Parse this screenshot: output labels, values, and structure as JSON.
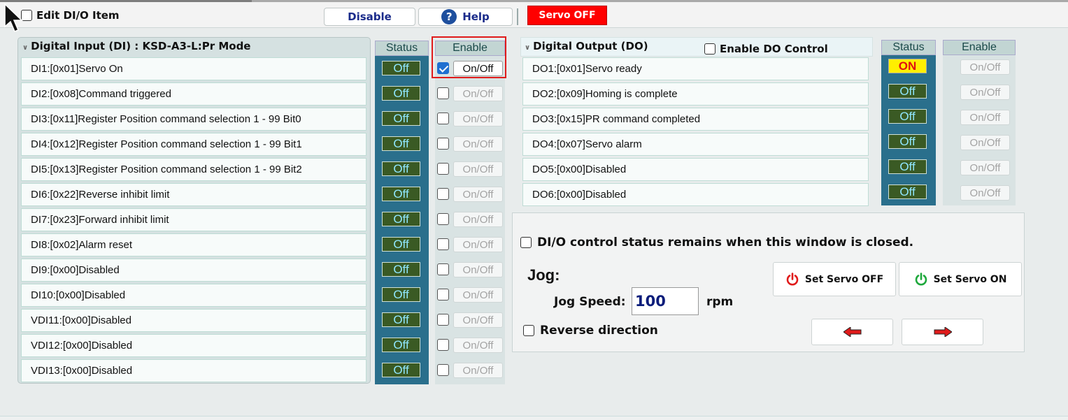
{
  "toolbar": {
    "edit_label": "Edit DI/O Item",
    "disable_label": "Disable",
    "help_label": "Help",
    "servo_status": "Servo OFF",
    "colors": {
      "servo_status_bg": "#ff0000",
      "help_icon": "#1e4f9e"
    }
  },
  "di": {
    "title": "Digital Input (DI) : KSD-A3-L:Pr Mode",
    "status_header": "Status",
    "enable_header": "Enable",
    "items": [
      {
        "label": "DI1:[0x01]Servo On",
        "status": "Off",
        "enabled": true,
        "toggle": "On/Off"
      },
      {
        "label": "DI2:[0x08]Command triggered",
        "status": "Off",
        "enabled": false,
        "toggle": "On/Off"
      },
      {
        "label": "DI3:[0x11]Register Position command selection 1 - 99 Bit0",
        "status": "Off",
        "enabled": false,
        "toggle": "On/Off"
      },
      {
        "label": "DI4:[0x12]Register Position command selection 1 - 99 Bit1",
        "status": "Off",
        "enabled": false,
        "toggle": "On/Off"
      },
      {
        "label": "DI5:[0x13]Register Position command selection 1 - 99 Bit2",
        "status": "Off",
        "enabled": false,
        "toggle": "On/Off"
      },
      {
        "label": "DI6:[0x22]Reverse inhibit limit",
        "status": "Off",
        "enabled": false,
        "toggle": "On/Off"
      },
      {
        "label": "DI7:[0x23]Forward inhibit limit",
        "status": "Off",
        "enabled": false,
        "toggle": "On/Off"
      },
      {
        "label": "DI8:[0x02]Alarm reset",
        "status": "Off",
        "enabled": false,
        "toggle": "On/Off"
      },
      {
        "label": "DI9:[0x00]Disabled",
        "status": "Off",
        "enabled": false,
        "toggle": "On/Off"
      },
      {
        "label": "DI10:[0x00]Disabled",
        "status": "Off",
        "enabled": false,
        "toggle": "On/Off"
      },
      {
        "label": "VDI11:[0x00]Disabled",
        "status": "Off",
        "enabled": false,
        "toggle": "On/Off"
      },
      {
        "label": "VDI12:[0x00]Disabled",
        "status": "Off",
        "enabled": false,
        "toggle": "On/Off"
      },
      {
        "label": "VDI13:[0x00]Disabled",
        "status": "Off",
        "enabled": false,
        "toggle": "On/Off"
      }
    ]
  },
  "do": {
    "title": "Digital Output (DO)",
    "enable_control_label": "Enable DO Control",
    "status_header": "Status",
    "enable_header": "Enable",
    "items": [
      {
        "label": "DO1:[0x01]Servo ready",
        "status": "ON",
        "toggle": "On/Off"
      },
      {
        "label": "DO2:[0x09]Homing is complete",
        "status": "Off",
        "toggle": "On/Off"
      },
      {
        "label": "DO3:[0x15]PR command completed",
        "status": "Off",
        "toggle": "On/Off"
      },
      {
        "label": "DO4:[0x07]Servo alarm",
        "status": "Off",
        "toggle": "On/Off"
      },
      {
        "label": "DO5:[0x00]Disabled",
        "status": "Off",
        "toggle": "On/Off"
      },
      {
        "label": "DO6:[0x00]Disabled",
        "status": "Off",
        "toggle": "On/Off"
      }
    ]
  },
  "control": {
    "remain_label": "DI/O control status remains when this window is closed.",
    "jog_title": "Jog:",
    "jog_speed_label": "Jog Speed:",
    "jog_speed_value": "100",
    "rpm_label": "rpm",
    "reverse_label": "Reverse direction",
    "servo_off_btn": "Set Servo OFF",
    "servo_on_btn": "Set Servo ON",
    "colors": {
      "power_off": "#e01b1b",
      "power_on": "#1ea83c",
      "arrow": "#e01b1b"
    }
  }
}
